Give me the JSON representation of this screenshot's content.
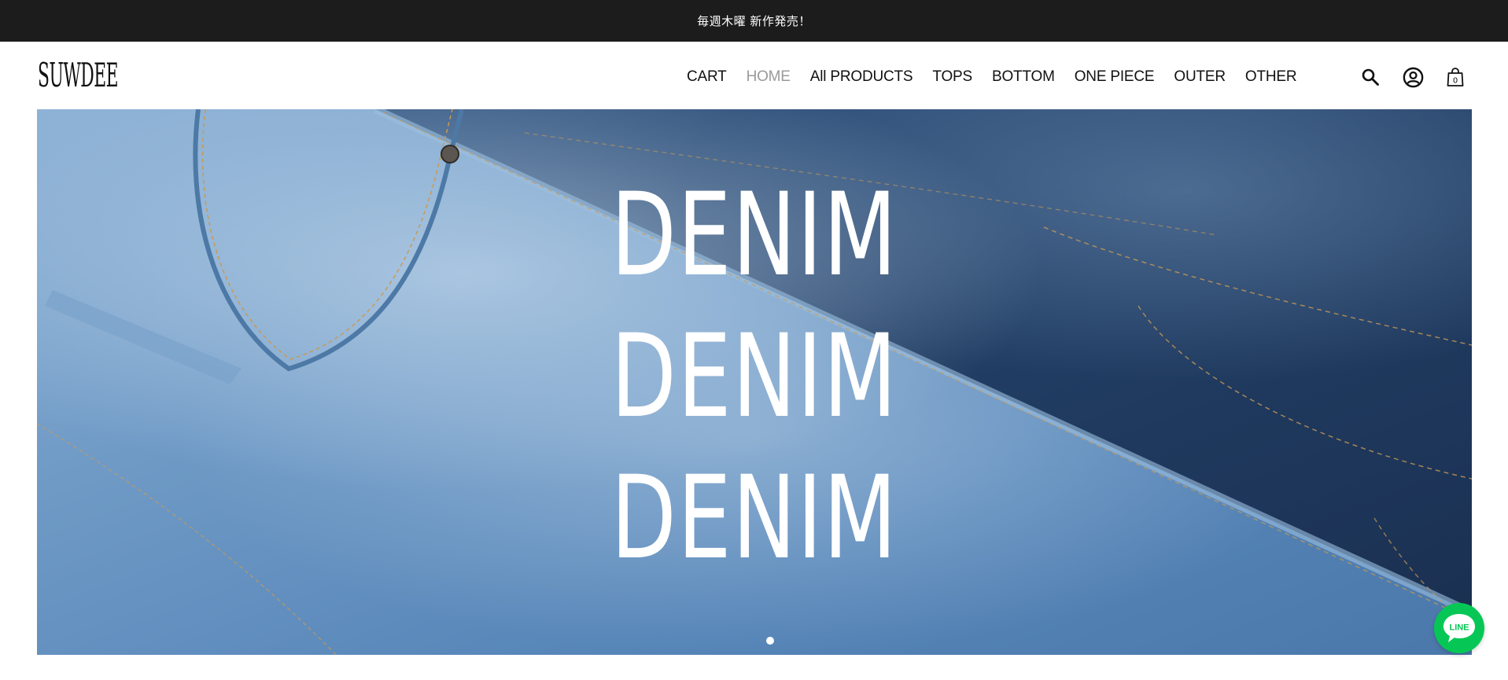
{
  "announcement": {
    "text": "毎週木曜 新作発売！"
  },
  "header": {
    "logo": "SUWDEE",
    "nav": [
      {
        "label": "CART",
        "active": false
      },
      {
        "label": "HOME",
        "active": true
      },
      {
        "label": "All PRODUCTS",
        "active": false
      },
      {
        "label": "TOPS",
        "active": false
      },
      {
        "label": "BOTTOM",
        "active": false
      },
      {
        "label": "ONE PIECE",
        "active": false
      },
      {
        "label": "OUTER",
        "active": false
      },
      {
        "label": "OTHER",
        "active": false
      }
    ],
    "icons": [
      "search-icon",
      "account-icon",
      "cart-bag-icon"
    ],
    "cart_count": "0"
  },
  "hero": {
    "lines": [
      "DENIM",
      "DENIM",
      "DENIM"
    ],
    "slide_indicator": {
      "current": 1,
      "total": 1
    }
  },
  "line_button": {
    "label": "LINE",
    "color": "#06c755"
  },
  "colors": {
    "announcement_bg": "#1c1c1c",
    "nav_active": "#9a9a9a",
    "nav_text": "#111111"
  }
}
